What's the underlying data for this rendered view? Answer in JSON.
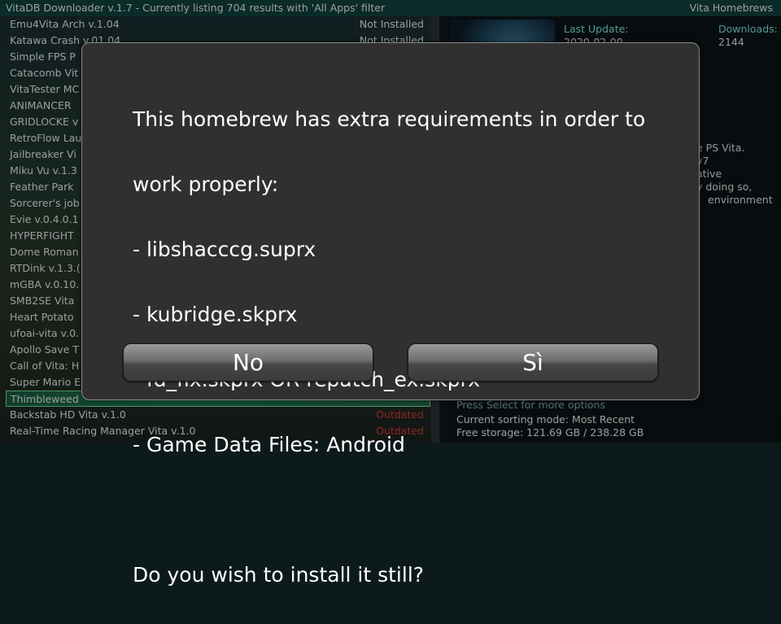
{
  "header": {
    "title": "VitaDB Downloader v.1.7 - Currently listing 704 results with 'All Apps' filter",
    "right": "Vita Homebrews"
  },
  "list": [
    {
      "name": "Emu4Vita Arch v.1.04",
      "status": "Not Installed",
      "status_type": "normal"
    },
    {
      "name": "Katawa Crash v.01.04",
      "status": "Not Installed",
      "status_type": "normal"
    },
    {
      "name": "Simple FPS P",
      "status": "",
      "status_type": "normal"
    },
    {
      "name": "Catacomb Vit",
      "status": "",
      "status_type": "normal"
    },
    {
      "name": "VitaTester MC",
      "status": "",
      "status_type": "normal"
    },
    {
      "name": "ANIMANCER",
      "status": "",
      "status_type": "normal"
    },
    {
      "name": "GRIDLOCKE v",
      "status": "",
      "status_type": "normal"
    },
    {
      "name": "RetroFlow Lau",
      "status": "",
      "status_type": "normal"
    },
    {
      "name": "Jailbreaker Vi",
      "status": "",
      "status_type": "normal"
    },
    {
      "name": "Miku Vu v.1.3",
      "status": "",
      "status_type": "normal"
    },
    {
      "name": "Feather Park",
      "status": "",
      "status_type": "normal"
    },
    {
      "name": "Sorcerer's job",
      "status": "",
      "status_type": "normal"
    },
    {
      "name": "Evie v.0.4.0.1",
      "status": "",
      "status_type": "normal"
    },
    {
      "name": "HYPERFIGHT",
      "status": "",
      "status_type": "normal"
    },
    {
      "name": "Dome Roman",
      "status": "",
      "status_type": "normal"
    },
    {
      "name": "RTDink v.1.3.(",
      "status": "",
      "status_type": "normal"
    },
    {
      "name": "mGBA v.0.10.",
      "status": "",
      "status_type": "normal"
    },
    {
      "name": "SMB2SE Vita",
      "status": "",
      "status_type": "normal"
    },
    {
      "name": "Heart Potato",
      "status": "",
      "status_type": "normal"
    },
    {
      "name": "ufoai-vita v.0.",
      "status": "",
      "status_type": "normal"
    },
    {
      "name": "Apollo Save T",
      "status": "",
      "status_type": "normal"
    },
    {
      "name": "Call of Vita: H",
      "status": "",
      "status_type": "normal"
    },
    {
      "name": "Super Mario E",
      "status": "",
      "status_type": "normal"
    },
    {
      "name": "Thimbleweed",
      "status": "",
      "status_type": "normal",
      "selected": true
    },
    {
      "name": "Backstab HD Vita v.1.0",
      "status": "Outdated",
      "status_type": "outdated"
    },
    {
      "name": "Real-Time Racing Manager Vita v.1.0",
      "status": "Outdated",
      "status_type": "outdated"
    }
  ],
  "info": {
    "last_update_label": "Last Update:",
    "last_update_value": "2020-02-00",
    "downloads_label": "Downloads:",
    "downloads_value": "2144",
    "desc_lines": [
      "e PS Vita.",
      "v7",
      "ative",
      "y doing so,",
      "environment"
    ],
    "hint": "Press Select for more options",
    "sorting": "Current sorting mode: Most Recent",
    "storage": "Free storage: 121.69 GB / 238.28 GB"
  },
  "dialog": {
    "message_lines": [
      "This homebrew has extra requirements in order to",
      "work properly:",
      "- libshacccg.suprx",
      "- kubridge.skprx",
      "- fd_fix.skprx OR repatch_ex.skprx",
      "- Game Data Files: Android",
      "",
      "Do you wish to install it still?"
    ],
    "no_label": "No",
    "yes_label": "Sì"
  },
  "colors": {
    "header_bg": "#12433f",
    "accent_text": "#7fe9e2",
    "outdated": "#e03a3a",
    "selected_border": "#76e09c"
  }
}
